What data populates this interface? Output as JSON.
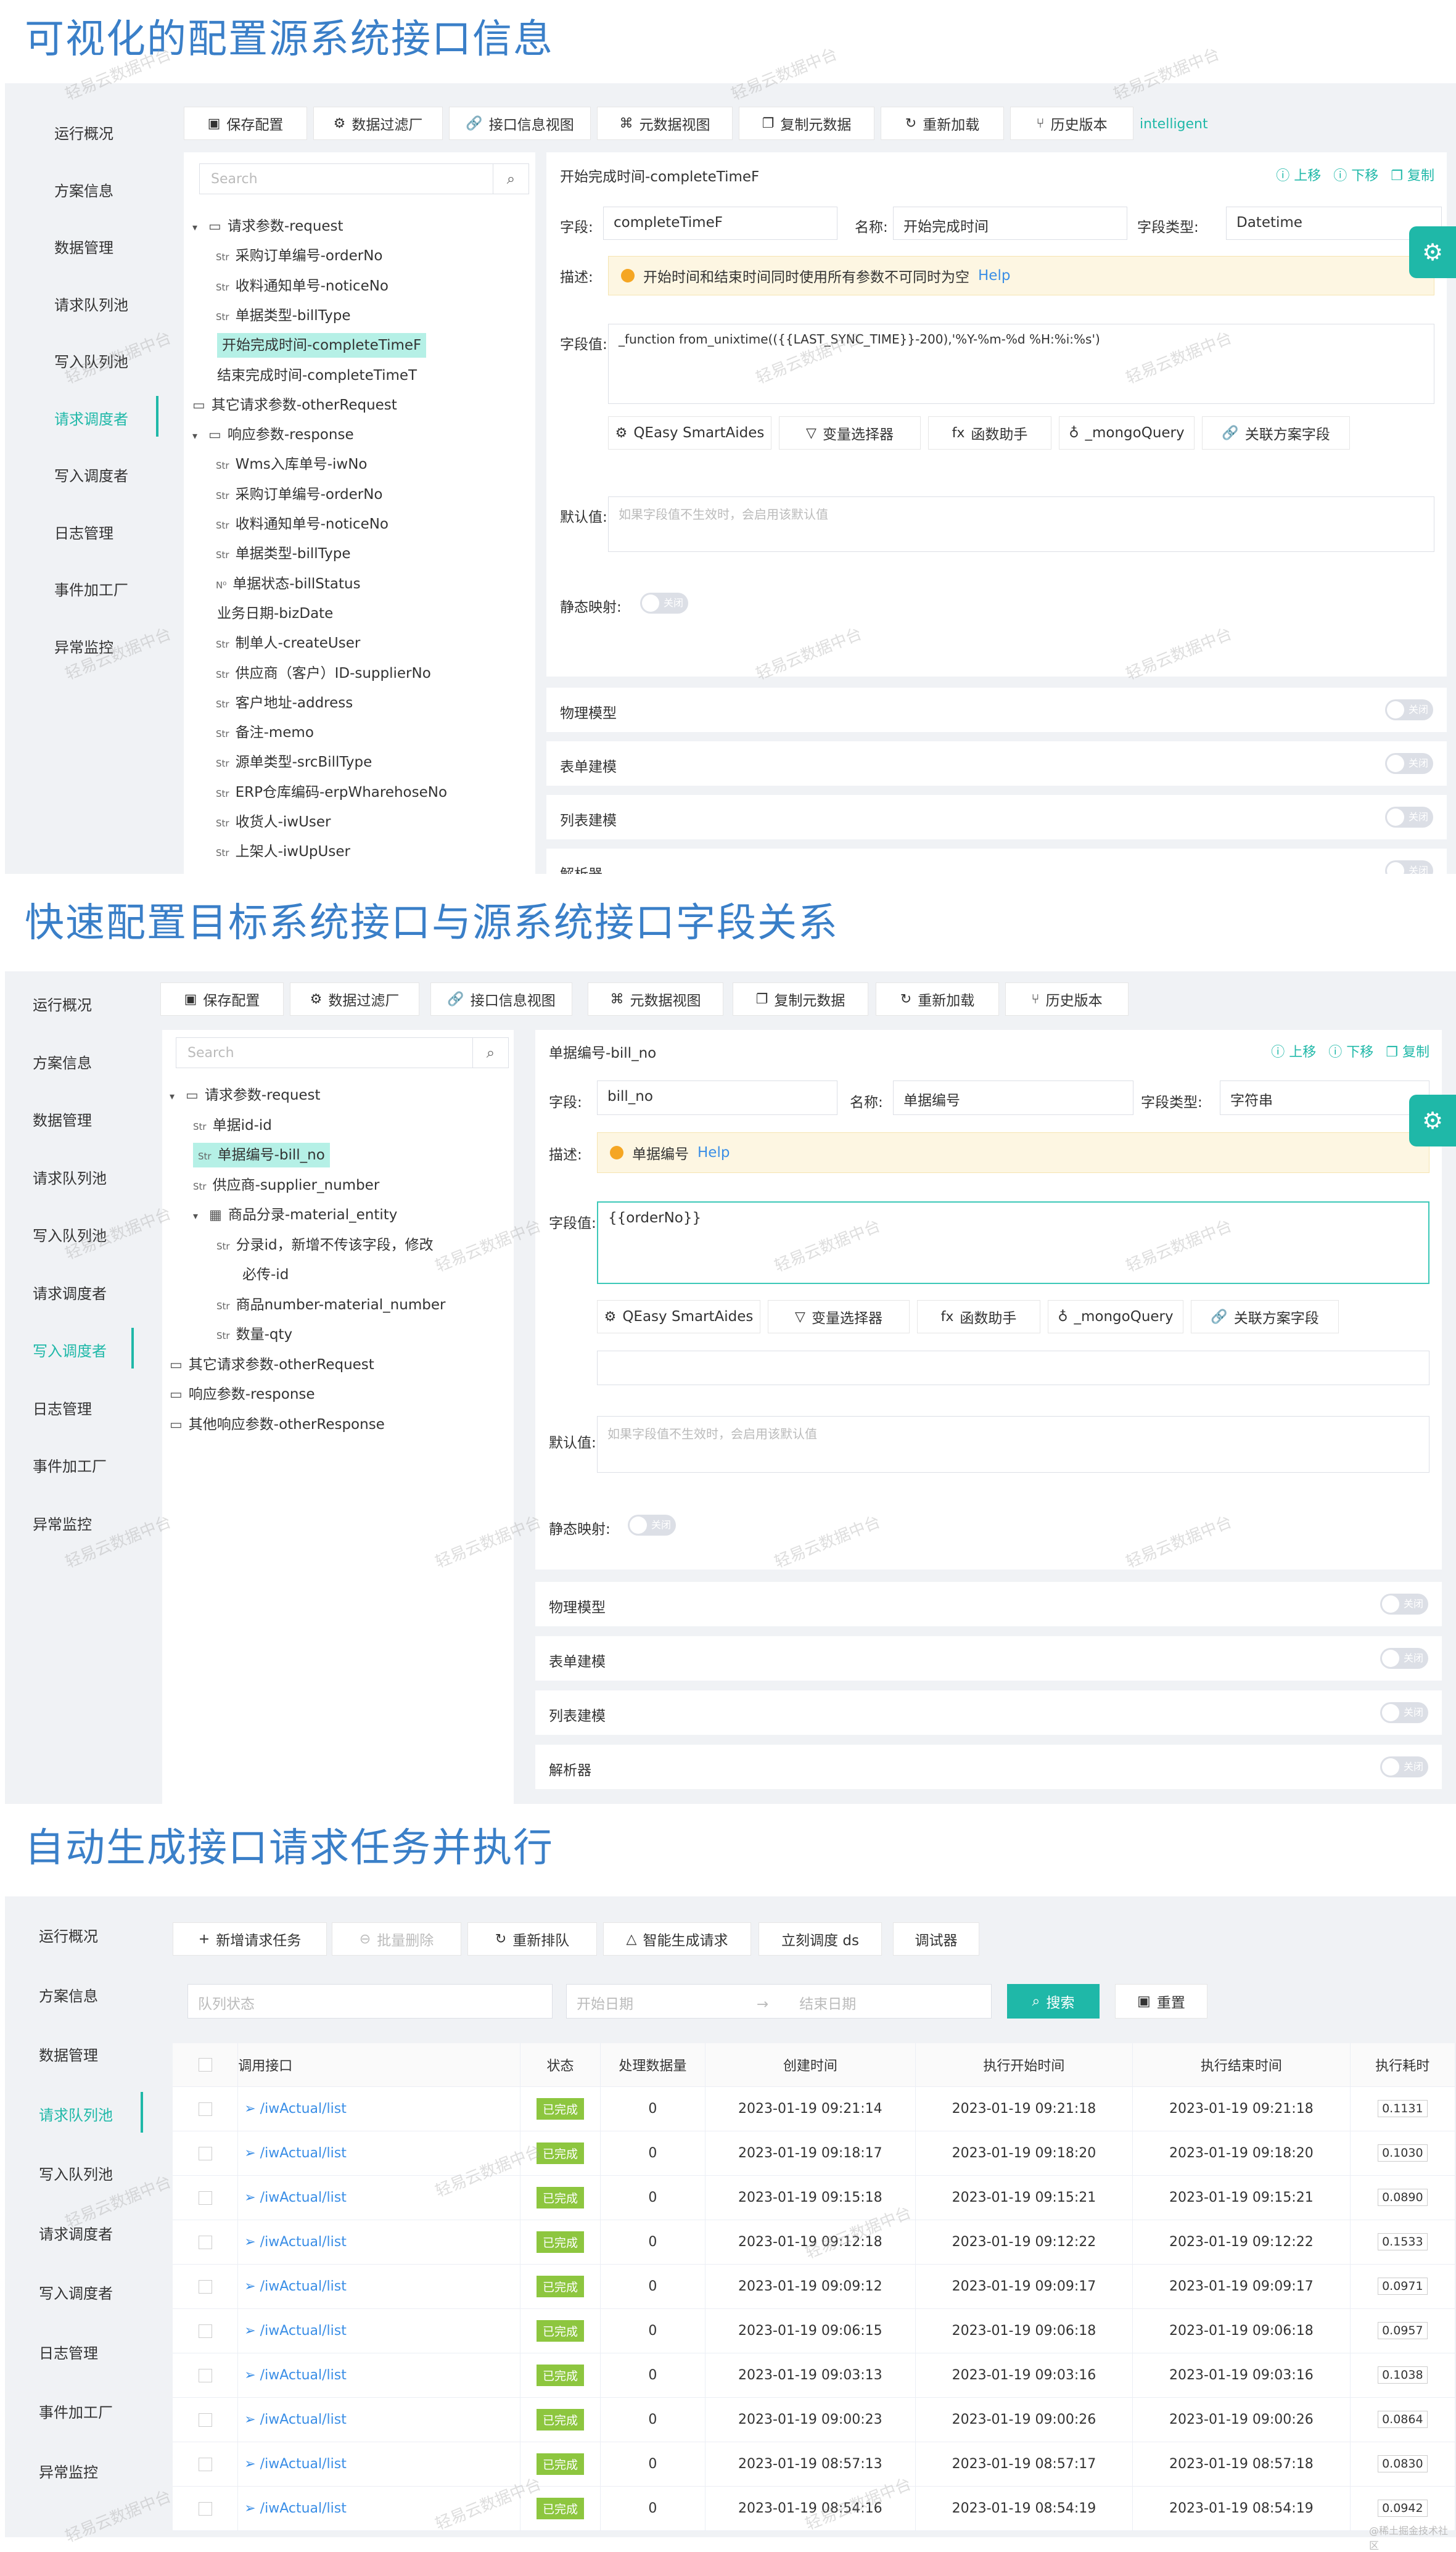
{
  "titles": [
    "可视化的配置源系统接口信息",
    "快速配置目标系统接口与源系统接口字段关系",
    "自动生成接口请求任务并执行"
  ],
  "sidebar1": [
    "运行概况",
    "方案信息",
    "数据管理",
    "请求队列池",
    "写入队列池",
    "请求调度者",
    "写入调度者",
    "日志管理",
    "事件加工厂",
    "异常监控"
  ],
  "sidebar2": [
    "运行概况",
    "方案信息",
    "数据管理",
    "请求队列池",
    "写入队列池",
    "请求调度者",
    "写入调度者",
    "日志管理",
    "事件加工厂",
    "异常监控"
  ],
  "sidebar3": [
    "运行概况",
    "方案信息",
    "数据管理",
    "请求队列池",
    "写入队列池",
    "请求调度者",
    "写入调度者",
    "日志管理",
    "事件加工厂",
    "异常监控"
  ],
  "toolbar1": {
    "save": "保存配置",
    "filter": "数据过滤厂",
    "api_view": "接口信息视图",
    "meta_view": "元数据视图",
    "copy_meta": "复制元数据",
    "reload": "重新加载",
    "history": "历史版本",
    "intelligent": "intelligent"
  },
  "toolbar2": {
    "save": "保存配置",
    "filter": "数据过滤厂",
    "api_view": "接口信息视图",
    "meta_view": "元数据视图",
    "copy_meta": "复制元数据",
    "reload": "重新加载",
    "history": "历史版本"
  },
  "search_ph": "Search",
  "tree1": [
    {
      "t": "请求参数-request",
      "k": "folder",
      "a": "▾",
      "x": 0
    },
    {
      "t": "采购订单编号-orderNo",
      "k": "str",
      "x": 1
    },
    {
      "t": "收料通知单号-noticeNo",
      "k": "str",
      "x": 1
    },
    {
      "t": "单据类型-billType",
      "k": "str",
      "x": 1
    },
    {
      "t": "开始完成时间-completeTimeF",
      "k": "sel",
      "x": 1
    },
    {
      "t": "结束完成时间-completeTimeT",
      "k": "plain",
      "x": 1
    },
    {
      "t": "其它请求参数-otherRequest",
      "k": "folder",
      "x": 0
    },
    {
      "t": "响应参数-response",
      "k": "folder",
      "a": "▾",
      "x": 0
    },
    {
      "t": "Wms入库单号-iwNo",
      "k": "str",
      "x": 1
    },
    {
      "t": "采购订单编号-orderNo",
      "k": "str",
      "x": 1
    },
    {
      "t": "收料通知单号-noticeNo",
      "k": "str",
      "x": 1
    },
    {
      "t": "单据类型-billType",
      "k": "str",
      "x": 1
    },
    {
      "t": "单据状态-billStatus",
      "k": "num",
      "x": 1
    },
    {
      "t": "业务日期-bizDate",
      "k": "plain",
      "x": 1
    },
    {
      "t": "制单人-createUser",
      "k": "str",
      "x": 1
    },
    {
      "t": "供应商（客户）ID-supplierNo",
      "k": "str",
      "x": 1
    },
    {
      "t": "客户地址-address",
      "k": "str",
      "x": 1
    },
    {
      "t": "备注-memo",
      "k": "str",
      "x": 1
    },
    {
      "t": "源单类型-srcBillType",
      "k": "str",
      "x": 1
    },
    {
      "t": "ERP仓库编码-erpWharehoseNo",
      "k": "str",
      "x": 1
    },
    {
      "t": "收货人-iwUser",
      "k": "str",
      "x": 1
    },
    {
      "t": "上架人-iwUpUser",
      "k": "str",
      "x": 1
    }
  ],
  "tree2": [
    {
      "t": "请求参数-request",
      "k": "folder",
      "a": "▾",
      "x": 0
    },
    {
      "t": "单据id-id",
      "k": "str",
      "x": 1
    },
    {
      "t": "单据编号-bill_no",
      "k": "strsel",
      "x": 1
    },
    {
      "t": "供应商-supplier_number",
      "k": "str",
      "x": 1
    },
    {
      "t": "商品分录-material_entity",
      "k": "table",
      "a": "▾",
      "x": 1
    },
    {
      "t": "分录id，新增不传该字段，修改",
      "k": "str",
      "x": 2
    },
    {
      "t": "必传-id",
      "k": "cont",
      "x": 2
    },
    {
      "t": "商品number-material_number",
      "k": "str",
      "x": 2
    },
    {
      "t": "数量-qty",
      "k": "str",
      "x": 2
    },
    {
      "t": "其它请求参数-otherRequest",
      "k": "folder",
      "x": 0
    },
    {
      "t": "响应参数-response",
      "k": "folder",
      "x": 0
    },
    {
      "t": "其他响应参数-otherResponse",
      "k": "folder",
      "x": 0
    }
  ],
  "form1": {
    "title": "开始完成时间-completeTimeF",
    "up": "上移",
    "down": "下移",
    "copy": "复制",
    "field_label": "字段:",
    "field": "completeTimeF",
    "name_label": "名称:",
    "name": "开始完成时间",
    "type_label": "字段类型:",
    "type": "Datetime",
    "desc_label": "描述:",
    "desc": "开始时间和结束时间同时使用所有参数不可同时为空",
    "help": "Help",
    "value_label": "字段值:",
    "value": "_function from_unixtime(({{LAST_SYNC_TIME}}-200),'%Y-%m-%d %H:%i:%s')",
    "tools": [
      "QEasy SmartAides",
      "变量选择器",
      "函数助手",
      "_mongoQuery",
      "关联方案字段"
    ],
    "default_label": "默认值:",
    "default_ph": "如果字段值不生效时，会启用该默认值",
    "static_label": "静态映射:",
    "off": "关闭",
    "sections": [
      "物理模型",
      "表单建模",
      "列表建模",
      "解析器"
    ]
  },
  "form2": {
    "title": "单据编号-bill_no",
    "up": "上移",
    "down": "下移",
    "copy": "复制",
    "field_label": "字段:",
    "field": "bill_no",
    "name_label": "名称:",
    "name": "单据编号",
    "type_label": "字段类型:",
    "type": "字符串",
    "desc_label": "描述:",
    "desc": "单据编号",
    "help": "Help",
    "value_label": "字段值:",
    "value": "{{orderNo}}",
    "tools": [
      "QEasy SmartAides",
      "变量选择器",
      "函数助手",
      "_mongoQuery",
      "关联方案字段"
    ],
    "default_label": "默认值:",
    "default_ph": "如果字段值不生效时，会启用该默认值",
    "static_label": "静态映射:",
    "off": "关闭",
    "sections": [
      "物理模型",
      "表单建模",
      "列表建模",
      "解析器"
    ]
  },
  "toolbar3": {
    "add": "新增请求任务",
    "batch_del": "批量删除",
    "requeue": "重新排队",
    "smart_gen": "智能生成请求",
    "schedule": "立刻调度 ds",
    "debugger": "调试器"
  },
  "filters": {
    "queue_ph": "队列状态",
    "start_ph": "开始日期",
    "end_ph": "结束日期",
    "search": "搜索",
    "reset": "重置"
  },
  "table": {
    "headers": [
      "调用接口",
      "状态",
      "处理数据量",
      "创建时间",
      "执行开始时间",
      "执行结束时间",
      "执行耗时"
    ],
    "rows": [
      [
        "/iwActual/list",
        "已完成",
        "0",
        "2023-01-19 09:21:14",
        "2023-01-19 09:21:18",
        "2023-01-19 09:21:18",
        "0.1131"
      ],
      [
        "/iwActual/list",
        "已完成",
        "0",
        "2023-01-19 09:18:17",
        "2023-01-19 09:18:20",
        "2023-01-19 09:18:20",
        "0.1030"
      ],
      [
        "/iwActual/list",
        "已完成",
        "0",
        "2023-01-19 09:15:18",
        "2023-01-19 09:15:21",
        "2023-01-19 09:15:21",
        "0.0890"
      ],
      [
        "/iwActual/list",
        "已完成",
        "0",
        "2023-01-19 09:12:18",
        "2023-01-19 09:12:22",
        "2023-01-19 09:12:22",
        "0.1533"
      ],
      [
        "/iwActual/list",
        "已完成",
        "0",
        "2023-01-19 09:09:12",
        "2023-01-19 09:09:17",
        "2023-01-19 09:09:17",
        "0.0971"
      ],
      [
        "/iwActual/list",
        "已完成",
        "0",
        "2023-01-19 09:06:15",
        "2023-01-19 09:06:18",
        "2023-01-19 09:06:18",
        "0.0957"
      ],
      [
        "/iwActual/list",
        "已完成",
        "0",
        "2023-01-19 09:03:13",
        "2023-01-19 09:03:16",
        "2023-01-19 09:03:16",
        "0.1038"
      ],
      [
        "/iwActual/list",
        "已完成",
        "0",
        "2023-01-19 09:00:23",
        "2023-01-19 09:00:26",
        "2023-01-19 09:00:26",
        "0.0864"
      ],
      [
        "/iwActual/list",
        "已完成",
        "0",
        "2023-01-19 08:57:13",
        "2023-01-19 08:57:17",
        "2023-01-19 08:57:18",
        "0.0830"
      ],
      [
        "/iwActual/list",
        "已完成",
        "0",
        "2023-01-19 08:54:16",
        "2023-01-19 08:54:19",
        "2023-01-19 08:54:19",
        "0.0942"
      ]
    ]
  },
  "watermark": "轻易云数据中台",
  "footer_mark": "@稀土掘金技术社区",
  "colors": {
    "accent": "#1fb8a8",
    "title": "#3a7fc8",
    "done": "#8dc63f"
  }
}
